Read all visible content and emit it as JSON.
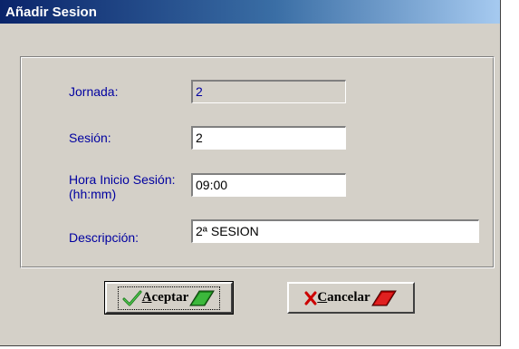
{
  "window": {
    "title": "Añadir Sesion"
  },
  "form": {
    "jornada_label": "Jornada:",
    "jornada_value": "2",
    "sesion_label": "Sesión:",
    "sesion_value": "2",
    "hora_label_line1": "Hora Inicio Sesión:",
    "hora_label_line2": "(hh:mm)",
    "hora_value": "09:00",
    "descripcion_label": "Descripción:",
    "descripcion_value": "2ª SESION"
  },
  "buttons": {
    "aceptar_accel": "A",
    "aceptar_rest": "ceptar",
    "cancelar_accel": "C",
    "cancelar_rest": "ancelar"
  },
  "icons": {
    "aceptar_check": "check-icon",
    "aceptar_pencil": "green-pencil-icon",
    "cancelar_x": "x-icon",
    "cancelar_pencil": "red-pencil-icon"
  },
  "colors": {
    "title_gradient_start": "#0a246a",
    "title_gradient_end": "#a6caf0",
    "label_color": "#0000a0",
    "dialog_background": "#d4d0c8"
  }
}
